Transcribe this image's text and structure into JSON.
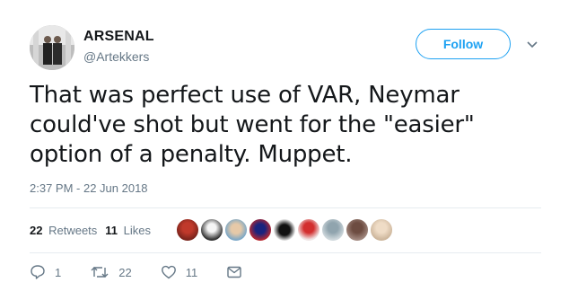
{
  "account": {
    "name": "ARSENAL",
    "handle": "@Artekkers",
    "follow_label": "Follow"
  },
  "tweet": {
    "text": "That was perfect use of VAR, Neymar could've shot but went for the \"easier\" option of a penalty. Muppet.",
    "timestamp": "2:37 PM - 22 Jun 2018"
  },
  "stats": {
    "retweets_count": "22",
    "retweets_label": "Retweets",
    "likes_count": "11",
    "likes_label": "Likes"
  },
  "actions": {
    "reply_count": "1",
    "retweet_count": "22",
    "like_count": "11"
  },
  "icons": {
    "reply": "reply-icon",
    "retweet": "retweet-icon",
    "like": "heart-icon",
    "message": "envelope-icon",
    "menu": "chevron-down-icon"
  },
  "colors": {
    "accent": "#1da1f2",
    "secondary_text": "#657786",
    "divider": "#e6ecf0"
  }
}
